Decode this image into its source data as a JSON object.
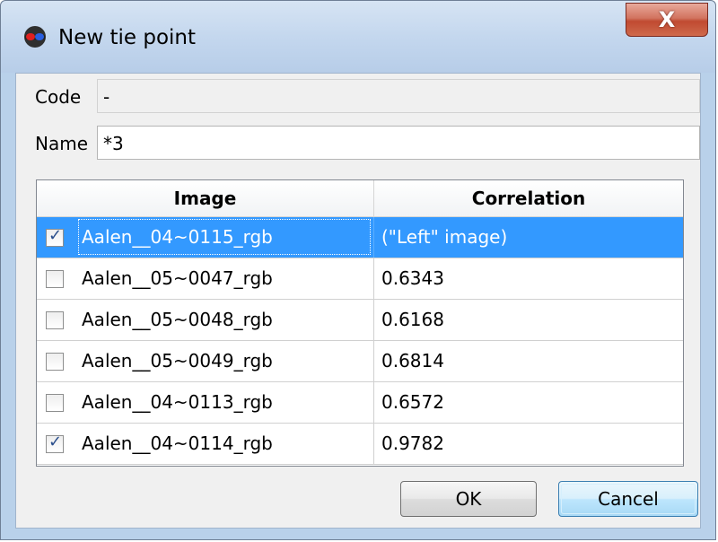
{
  "window": {
    "title": "New tie point",
    "close_label": "X"
  },
  "form": {
    "code_label": "Code",
    "code_value": "-",
    "name_label": "Name",
    "name_value": "*3"
  },
  "table": {
    "headers": [
      "Image",
      "Correlation"
    ],
    "rows": [
      {
        "image": "Aalen__04~0115_rgb",
        "correlation": "(\"Left\" image)",
        "checked": true,
        "selected": true
      },
      {
        "image": "Aalen__05~0047_rgb",
        "correlation": "0.6343",
        "checked": false,
        "selected": false
      },
      {
        "image": "Aalen__05~0048_rgb",
        "correlation": "0.6168",
        "checked": false,
        "selected": false
      },
      {
        "image": "Aalen__05~0049_rgb",
        "correlation": "0.6814",
        "checked": false,
        "selected": false
      },
      {
        "image": "Aalen__04~0113_rgb",
        "correlation": "0.6572",
        "checked": false,
        "selected": false
      },
      {
        "image": "Aalen__04~0114_rgb",
        "correlation": "0.9782",
        "checked": true,
        "selected": false
      }
    ]
  },
  "buttons": {
    "ok": "OK",
    "cancel": "Cancel"
  },
  "colors": {
    "selection": "#3399ff",
    "titlebar": "#c4d7ee",
    "close": "#c04a31"
  },
  "icons": {
    "app": "stereo-glasses-icon",
    "close": "close-icon",
    "check": "checkmark-icon"
  }
}
